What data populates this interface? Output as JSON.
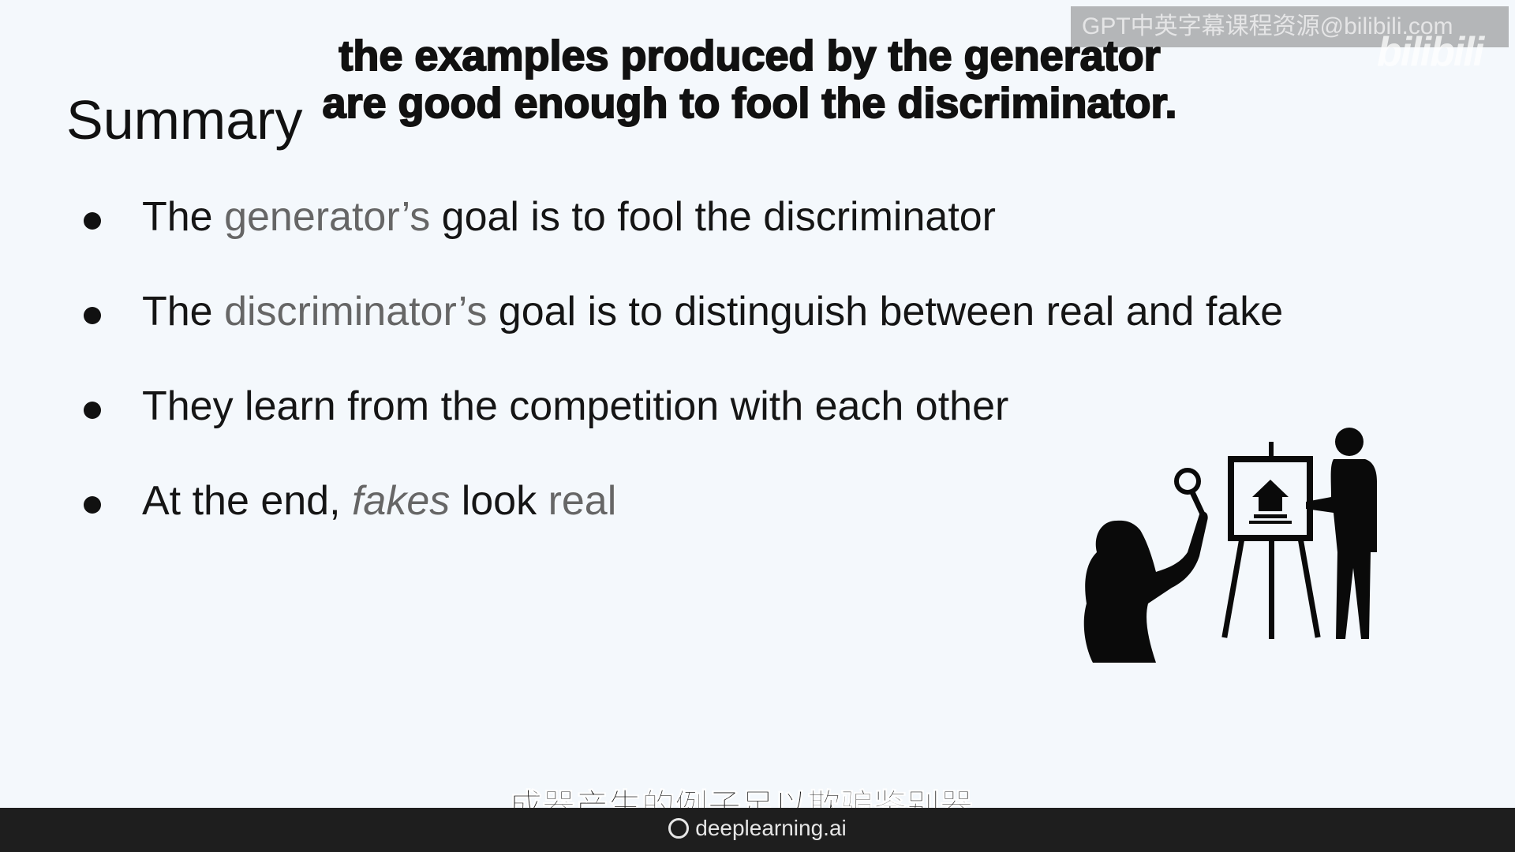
{
  "watermark": {
    "text": "GPT中英字幕课程资源@bilibili.com",
    "sub_text": "...",
    "logo_text": "bilibili"
  },
  "subtitle": {
    "line1": "the examples produced by the generator",
    "line2": "are good enough to fool the discriminator.",
    "chinese": "成器产生的例子足以欺骗鉴别器。"
  },
  "slide": {
    "title": "Summary",
    "bullets": [
      {
        "pre": "The ",
        "hl": "generator’s",
        "post": " goal is to fool the discriminator"
      },
      {
        "pre": "The ",
        "hl": "discriminator’s",
        "post": " goal is to distinguish between real and fake"
      },
      {
        "pre": "They learn from the competition with each other",
        "hl": "",
        "post": ""
      },
      {
        "pre": "At the end, ",
        "it": "fakes",
        "mid": " look ",
        "hl": "real"
      }
    ]
  },
  "footer": {
    "brand": "deeplearning.ai"
  },
  "colors": {
    "background": "#f4f8fc",
    "highlight": "#666666",
    "footer": "#1e1e1e"
  }
}
